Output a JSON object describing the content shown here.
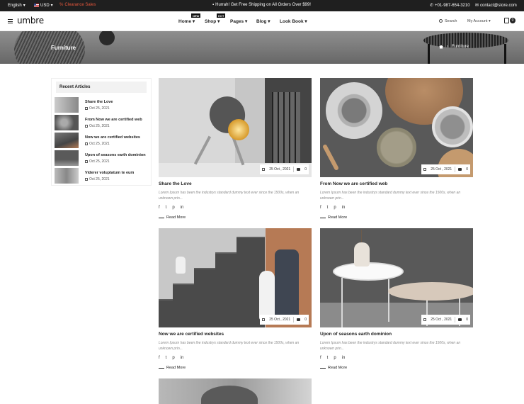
{
  "topbar": {
    "language": "English",
    "currency": "USD",
    "clearance": "Clearance Sales",
    "shipping": "Hurrah! Get Free Shipping on All Orders Over $99!",
    "phone": "+01-987-654-3210",
    "email": "contact@store.com"
  },
  "header": {
    "logo": "umbre",
    "nav": [
      {
        "label": "Home",
        "badge": "NEW"
      },
      {
        "label": "Shop",
        "badge": "HOT"
      },
      {
        "label": "Pages",
        "badge": ""
      },
      {
        "label": "Blog",
        "badge": ""
      },
      {
        "label": "Look Book",
        "badge": ""
      }
    ],
    "search_label": "Search",
    "account_label": "My Account",
    "cart_count": "0"
  },
  "hero": {
    "title": "Furniture",
    "breadcrumb": [
      "Furniture"
    ]
  },
  "sidebar": {
    "title": "Recent Articles",
    "posts": [
      {
        "title": "Share the Love",
        "date": "Oct 25, 2021"
      },
      {
        "title": "From Now we are certified web",
        "date": "Oct 25, 2021"
      },
      {
        "title": "Now we are certified websites",
        "date": "Oct 25, 2021"
      },
      {
        "title": "Upon of seasons earth dominion",
        "date": "Oct 25, 2021"
      },
      {
        "title": "Viderer voluptatum te eum",
        "date": "Oct 25, 2021"
      }
    ]
  },
  "articles": [
    {
      "title": "Share the Love",
      "date": "25 Oct , 2021",
      "comments": "0",
      "excerpt": "Lorem Ipsum has been the industrys standard dummy text ever since the 1500s, when an unknown prin...",
      "read_more": "Read More"
    },
    {
      "title": "From Now we are certified web",
      "date": "25 Oct , 2021",
      "comments": "0",
      "excerpt": "Lorem Ipsum has been the industrys standard dummy text ever since the 1500s, when an unknown prin...",
      "read_more": "Read More"
    },
    {
      "title": "Now we are certified websites",
      "date": "25 Oct , 2021",
      "comments": "0",
      "excerpt": "Lorem Ipsum has been the industrys standard dummy text ever since the 1500s, when an unknown prin...",
      "read_more": "Read More"
    },
    {
      "title": "Upon of seasons earth dominion",
      "date": "25 Oct , 2021",
      "comments": "0",
      "excerpt": "Lorem Ipsum has been the industrys standard dummy text ever since the 1500s, when an unknown prin...",
      "read_more": "Read More"
    }
  ],
  "social_icons": {
    "facebook": "f",
    "twitter": "t",
    "pinterest": "p",
    "linkedin": "in"
  },
  "colors": {
    "topbar_bg": "#1f1f1f",
    "clearance": "#e2563b"
  }
}
